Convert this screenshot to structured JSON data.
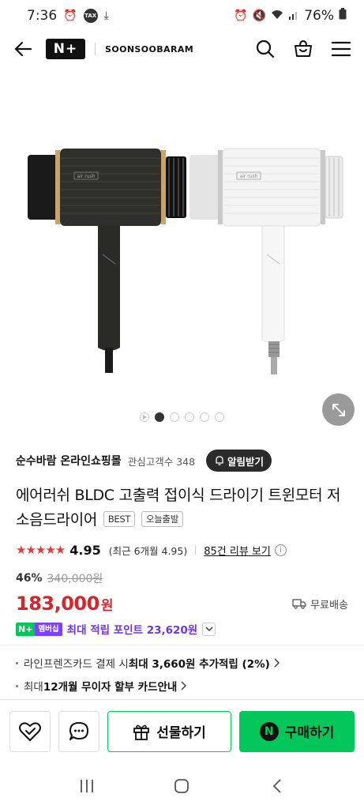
{
  "status_bar": {
    "time": "7:36",
    "tax_icon_text": "TAX",
    "battery": "76%"
  },
  "header": {
    "logo_text": "N+",
    "store_name": "SOONSOOBARAM"
  },
  "gallery": {
    "total_slides": 6,
    "active_index": 1,
    "product_label_left": "air rush",
    "product_label_right": "air rush"
  },
  "seller": {
    "name": "순수바람 온라인쇼핑몰",
    "followers_label": "관심고객수 348",
    "alarm_label": "알림받기"
  },
  "product": {
    "title": "에어러쉬 BLDC 고출력 접이식 드라이기 트윈모터 저소음드라이어",
    "badges": [
      "BEST",
      "오늘출발"
    ]
  },
  "rating": {
    "stars": "★★★★★",
    "score": "4.95",
    "recent": "(최근 6개월 4.95)",
    "reviews_link": "85건 리뷰 보기"
  },
  "price": {
    "discount": "46%",
    "original": "340,000원",
    "current": "183,000",
    "currency": "원",
    "shipping": "무료배송"
  },
  "points": {
    "badge_left": "N+",
    "badge_right": "멤버십",
    "text": "최대 적립 포인트 23,620원"
  },
  "benefits": {
    "card_prefix": "라인프렌즈카드 결제 시 ",
    "card_bold": "최대 3,660원 추가적립 (2%)",
    "installment_prefix": "최대 ",
    "installment_bold": "12개월 무이자 할부 카드안내"
  },
  "bottom_bar": {
    "gift_label": "선물하기",
    "buy_label": "구매하기",
    "buy_icon_text": "N"
  },
  "colors": {
    "naver_green": "#03c75a",
    "price_red": "#d6262c",
    "membership_purple": "#6d36e8"
  }
}
